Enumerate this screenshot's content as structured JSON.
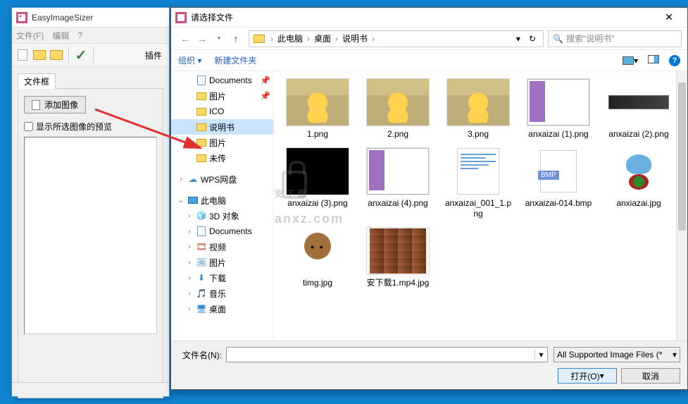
{
  "app": {
    "title": "EasyImageSizer",
    "menu": {
      "file": "文件(F)",
      "edit": "编辑",
      "help": "?"
    },
    "toolbar": {
      "plugin": "插件"
    },
    "tab": "文件框",
    "add_btn": "添加图像",
    "preview_chk": "显示所选图像的预览"
  },
  "dialog": {
    "title": "请选择文件",
    "breadcrumb": {
      "a": "此电脑",
      "b": "桌面",
      "c": "说明书"
    },
    "search_placeholder": "搜索\"说明书\"",
    "organize": "组织",
    "new_folder": "新建文件夹"
  },
  "tree": {
    "documents": "Documents",
    "tupian1": "图片",
    "ico": "ICO",
    "shuoming": "说明书",
    "tupian2": "图片",
    "weichuan": "未传",
    "wps": "WPS网盘",
    "thispc": "此电脑",
    "obj3d": "3D 对象",
    "documents2": "Documents",
    "video": "视频",
    "tupian3": "图片",
    "download": "下载",
    "music": "音乐",
    "desktop": "桌面"
  },
  "files": [
    {
      "name": "1.png",
      "kind": "cat"
    },
    {
      "name": "2.png",
      "kind": "cat"
    },
    {
      "name": "3.png",
      "kind": "cat"
    },
    {
      "name": "anxaizai (1).png",
      "kind": "explorer"
    },
    {
      "name": "anxaizai (2).png",
      "kind": "taskbar"
    },
    {
      "name": "anxaizai (3).png",
      "kind": "dark"
    },
    {
      "name": "anxaizai (4).png",
      "kind": "explorer"
    },
    {
      "name": "anxaizai_001_1.png",
      "kind": "doc"
    },
    {
      "name": "anxaizai-014.bmp",
      "kind": "bmp"
    },
    {
      "name": "anxiazai.jpg",
      "kind": "bluegirl"
    },
    {
      "name": "timg.jpg",
      "kind": "dog"
    },
    {
      "name": "安下载1.mp4.jpg",
      "kind": "grid"
    }
  ],
  "footer": {
    "filename_label": "文件名(N):",
    "filter": "All Supported Image Files (*",
    "open": "打开(O)",
    "cancel": "取消"
  },
  "watermark": "安下载",
  "site": "anxz.com"
}
